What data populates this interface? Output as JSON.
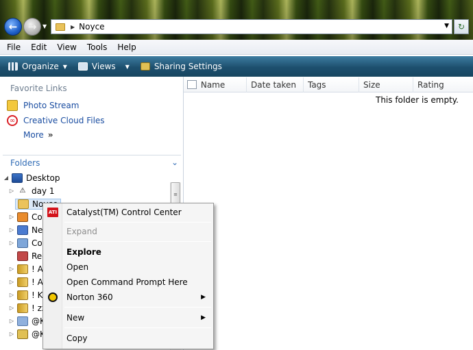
{
  "address": {
    "path": "Noyce"
  },
  "menu": [
    "File",
    "Edit",
    "View",
    "Tools",
    "Help"
  ],
  "toolbar": {
    "organize": "Organize",
    "views": "Views",
    "sharing": "Sharing Settings"
  },
  "favorites": {
    "heading": "Favorite Links",
    "items": [
      "Photo Stream",
      "Creative Cloud Files"
    ],
    "more": "More",
    "more_glyph": "»"
  },
  "folders": {
    "heading": "Folders",
    "tree": [
      "Desktop",
      "day 1",
      "Noyce",
      "Co",
      "Ne",
      "Co",
      "Rec",
      "! Al",
      "! Ac",
      "! KI",
      "! zz",
      "@K",
      "@K"
    ]
  },
  "columns": [
    "Name",
    "Date taken",
    "Tags",
    "Size",
    "Rating"
  ],
  "empty_message": "This folder is empty.",
  "context_menu": {
    "catalyst": "Catalyst(TM) Control Center",
    "ati_badge": "ATI",
    "expand": "Expand",
    "explore": "Explore",
    "open": "Open",
    "open_cmd": "Open Command Prompt Here",
    "norton": "Norton 360",
    "new": "New",
    "copy": "Copy"
  }
}
